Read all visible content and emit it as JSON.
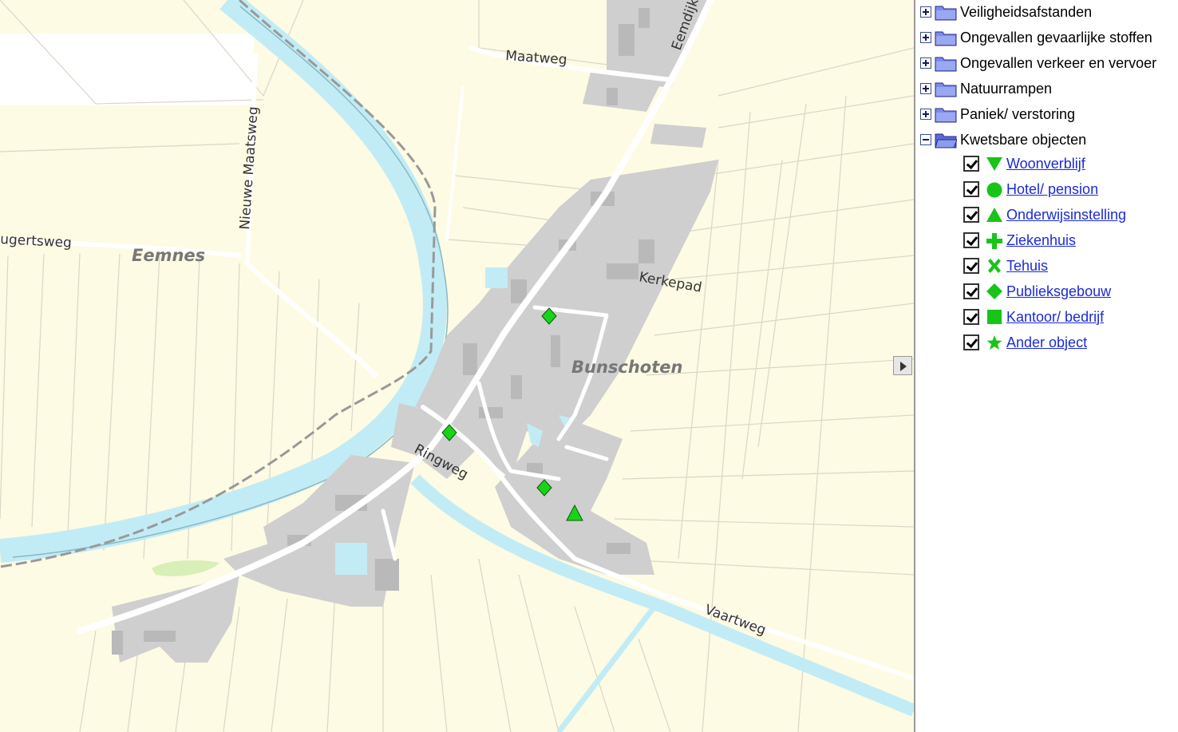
{
  "map": {
    "place_labels": [
      "Eemnes",
      "Bunschoten"
    ],
    "road_labels": [
      "Maatweg",
      "Eemdijk",
      "Nieuwe Maatsweg",
      "ugertsweg",
      "Kerkepad",
      "Ringweg",
      "Vaartweg"
    ],
    "marker_colors": {
      "fill": "#19d319",
      "stroke": "#0a5a0a"
    },
    "markers": [
      {
        "type": "Publieksgebouw",
        "icon": "diamond"
      },
      {
        "type": "Publieksgebouw",
        "icon": "diamond"
      },
      {
        "type": "Publieksgebouw",
        "icon": "diamond"
      },
      {
        "type": "Onderwijsinstelling",
        "icon": "triangle"
      }
    ]
  },
  "legend": {
    "groups": [
      {
        "label": "Veiligheidsafstanden",
        "expanded": false
      },
      {
        "label": "Ongevallen gevaarlijke stoffen",
        "expanded": false
      },
      {
        "label": "Ongevallen verkeer en vervoer",
        "expanded": false
      },
      {
        "label": "Natuurrampen",
        "expanded": false
      },
      {
        "label": "Paniek/ verstoring",
        "expanded": false
      },
      {
        "label": "Kwetsbare objecten",
        "expanded": true
      }
    ],
    "items": [
      {
        "label": "Woonverblijf",
        "icon": "triangle-down",
        "checked": true
      },
      {
        "label": "Hotel/ pension",
        "icon": "circle",
        "checked": true
      },
      {
        "label": "Onderwijsinstelling",
        "icon": "triangle-up",
        "checked": true
      },
      {
        "label": "Ziekenhuis",
        "icon": "plus",
        "checked": true
      },
      {
        "label": "Tehuis",
        "icon": "cross",
        "checked": true
      },
      {
        "label": "Publieksgebouw",
        "icon": "diamond",
        "checked": true
      },
      {
        "label": "Kantoor/ bedrijf",
        "icon": "square",
        "checked": true
      },
      {
        "label": "Ander object",
        "icon": "star",
        "checked": true
      }
    ],
    "colors": {
      "symbol": "#19c419",
      "folder": "#7a8ce8",
      "link": "#1b2bd6"
    }
  }
}
